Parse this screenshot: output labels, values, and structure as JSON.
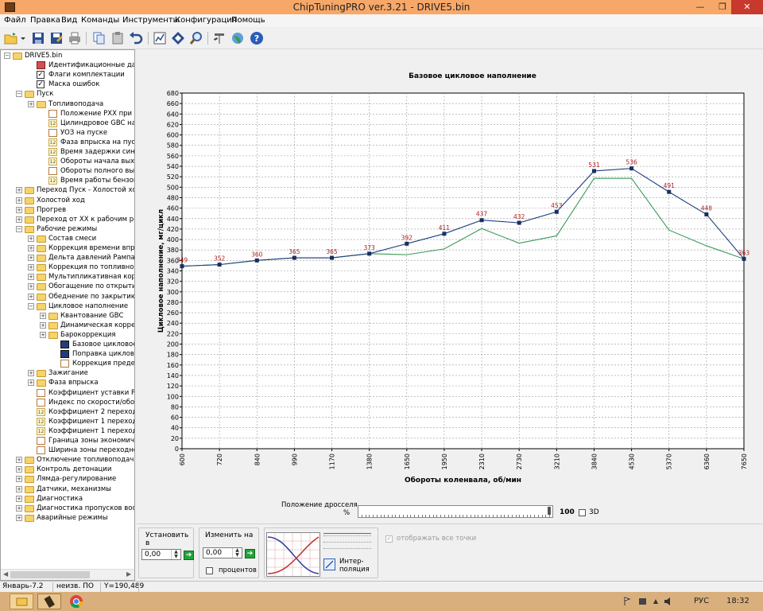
{
  "window": {
    "title": "ChipTuningPRO ver.3.21 - DRIVE5.bin",
    "controls": {
      "minimize": "—",
      "maximize": "❐",
      "close": "✕"
    }
  },
  "menu": [
    "Файл",
    "Правка",
    "Вид",
    "Команды",
    "Инструменты",
    "Конфигурация",
    "Помощь"
  ],
  "toolbar": {
    "icons": [
      "open-folder-icon",
      "save-icon",
      "save-as-icon",
      "print-icon",
      "copy-icon",
      "paste-icon",
      "undo-icon",
      "map-view-icon",
      "diamond-icon",
      "search-icon",
      "tools-icon",
      "globe-icon",
      "help-icon"
    ]
  },
  "tree": [
    {
      "label": "DRIVE5.bin",
      "level": 0,
      "exp": "-",
      "icon": "folder"
    },
    {
      "label": "Идентификационные данные",
      "level": 2,
      "icon": "id"
    },
    {
      "label": "Флаги комплектации",
      "level": 2,
      "icon": "check"
    },
    {
      "label": "Маска ошибок",
      "level": 2,
      "icon": "check"
    },
    {
      "label": "Пуск",
      "level": 1,
      "exp": "-",
      "icon": "folder"
    },
    {
      "label": "Топливоподача",
      "level": 2,
      "exp": "+",
      "icon": "folder"
    },
    {
      "label": "Положение РХХ при пуске",
      "level": 3,
      "icon": "graph"
    },
    {
      "label": "Цилиндровое GBC на пуске",
      "level": 3,
      "icon": "num"
    },
    {
      "label": "УОЗ на пуске",
      "level": 3,
      "icon": "graph"
    },
    {
      "label": "Фаза впрыска на пуске",
      "level": 3,
      "icon": "num"
    },
    {
      "label": "Время задержки синхрониз",
      "level": 3,
      "icon": "num"
    },
    {
      "label": "Обороты начала выхода из",
      "level": 3,
      "icon": "num"
    },
    {
      "label": "Обороты полного выхода из",
      "level": 3,
      "icon": "graph"
    },
    {
      "label": "Время работы бензонасоса",
      "level": 3,
      "icon": "num"
    },
    {
      "label": "Переход Пуск - Холостой ход",
      "level": 1,
      "exp": "+",
      "icon": "folder"
    },
    {
      "label": "Холостой ход",
      "level": 1,
      "exp": "+",
      "icon": "folder"
    },
    {
      "label": "Прогрев",
      "level": 1,
      "exp": "+",
      "icon": "folder"
    },
    {
      "label": "Переход от ХХ к рабочим режи",
      "level": 1,
      "exp": "+",
      "icon": "folder"
    },
    {
      "label": "Рабочие режимы",
      "level": 1,
      "exp": "-",
      "icon": "folder"
    },
    {
      "label": "Состав смеси",
      "level": 2,
      "exp": "+",
      "icon": "folder"
    },
    {
      "label": "Коррекция времени впрыск",
      "level": 2,
      "exp": "+",
      "icon": "folder"
    },
    {
      "label": "Дельта давлений Рампа <->",
      "level": 2,
      "exp": "+",
      "icon": "folder"
    },
    {
      "label": "Коррекция по топливной пл",
      "level": 2,
      "exp": "+",
      "icon": "folder"
    },
    {
      "label": "Мультипликативная коррек",
      "level": 2,
      "exp": "+",
      "icon": "folder"
    },
    {
      "label": "Обогащение по открытию д",
      "level": 2,
      "exp": "+",
      "icon": "folder"
    },
    {
      "label": "Обеднение по закрытию др",
      "level": 2,
      "exp": "+",
      "icon": "folder"
    },
    {
      "label": "Цикловое наполнение",
      "level": 2,
      "exp": "-",
      "icon": "folder"
    },
    {
      "label": "Квантование GBC",
      "level": 3,
      "exp": "+",
      "icon": "folder"
    },
    {
      "label": "Динамическая коррекц",
      "level": 3,
      "exp": "+",
      "icon": "folder"
    },
    {
      "label": "Барокоррекция",
      "level": 3,
      "exp": "+",
      "icon": "folder"
    },
    {
      "label": "Базовое цикловое напо",
      "level": 4,
      "icon": "bar"
    },
    {
      "label": "Поправка циклового на",
      "level": 4,
      "icon": "bar"
    },
    {
      "label": "Коррекция предельног",
      "level": 4,
      "icon": "graph"
    },
    {
      "label": "Зажигание",
      "level": 2,
      "exp": "+",
      "icon": "folder"
    },
    {
      "label": "Фаза впрыска",
      "level": 2,
      "exp": "+",
      "icon": "folder"
    },
    {
      "label": "Коэффициент уставки РХХ",
      "level": 2,
      "icon": "graph"
    },
    {
      "label": "Индекс по скорости/оборот",
      "level": 2,
      "icon": "graph"
    },
    {
      "label": "Коэффициент 2 переходног",
      "level": 2,
      "icon": "num"
    },
    {
      "label": "Коэффициент 1 переходног",
      "level": 2,
      "icon": "num"
    },
    {
      "label": "Коэффициент 1 переходног",
      "level": 2,
      "icon": "num"
    },
    {
      "label": "Граница зоны экономичного",
      "level": 2,
      "icon": "graph"
    },
    {
      "label": "Ширина зоны переходного р",
      "level": 2,
      "icon": "graph"
    },
    {
      "label": "Отключение топливоподачи",
      "level": 1,
      "exp": "+",
      "icon": "folder"
    },
    {
      "label": "Контроль детонации",
      "level": 1,
      "exp": "+",
      "icon": "folder"
    },
    {
      "label": "Лямда-регулирование",
      "level": 1,
      "exp": "+",
      "icon": "folder"
    },
    {
      "label": "Датчики, механизмы",
      "level": 1,
      "exp": "+",
      "icon": "folder"
    },
    {
      "label": "Диагностика",
      "level": 1,
      "exp": "+",
      "icon": "folder"
    },
    {
      "label": "Диагностика пропусков воспла",
      "level": 1,
      "exp": "+",
      "icon": "folder"
    },
    {
      "label": "Аварийные режимы",
      "level": 1,
      "exp": "+",
      "icon": "folder"
    }
  ],
  "chart_data": {
    "type": "line",
    "title": "Базовое цикловое наполнение",
    "xlabel": "Обороты коленвала, об/мин",
    "ylabel": "Цикловое наполнение, мг/цикл",
    "categories": [
      "600",
      "720",
      "840",
      "990",
      "1170",
      "1380",
      "1650",
      "1950",
      "2310",
      "2730",
      "3210",
      "3840",
      "4530",
      "5370",
      "6360",
      "7650"
    ],
    "ylim": [
      0,
      680
    ],
    "ytick_step": 20,
    "grid": true,
    "series": [
      {
        "name": "",
        "color": "#1f3f80",
        "markers": true,
        "values": [
          349,
          352,
          360,
          365,
          365,
          373,
          392,
          411,
          437,
          432,
          453,
          531,
          536,
          491,
          448,
          363
        ],
        "labels": [
          "349",
          "352",
          "360",
          "365",
          "365",
          "373",
          "392",
          "411",
          "437",
          "432",
          "453",
          "531",
          "536",
          "491",
          "448",
          "363"
        ]
      },
      {
        "name": "",
        "color": "#3a9a5a",
        "markers": false,
        "values": [
          349,
          352,
          360,
          365,
          365,
          373,
          371,
          382,
          421,
          393,
          407,
          517,
          517,
          418,
          388,
          363
        ]
      }
    ],
    "label_color": "#b02020"
  },
  "throttle": {
    "label": "Положение дросселя,",
    "unit": "%",
    "value": 100,
    "max": 100,
    "checkbox_3d": "3D"
  },
  "bottom": {
    "set_label": "Установить в",
    "set_value": "0,00",
    "change_label": "Изменить на",
    "change_value": "0,00",
    "percent_label": "процентов",
    "interp_label_1": "Интер-",
    "interp_label_2": "поляция",
    "show_all_points": "отображать все точки"
  },
  "status": {
    "date": "Январь-7.2",
    "software": "неизв. ПО",
    "coord": "Y=190,489"
  },
  "taskbar": {
    "lang": "РУС",
    "time": "18:32"
  },
  "colors": {
    "titlebar": "#f7a868",
    "taskbar": "#d9b07d",
    "close": "#c7392d"
  }
}
